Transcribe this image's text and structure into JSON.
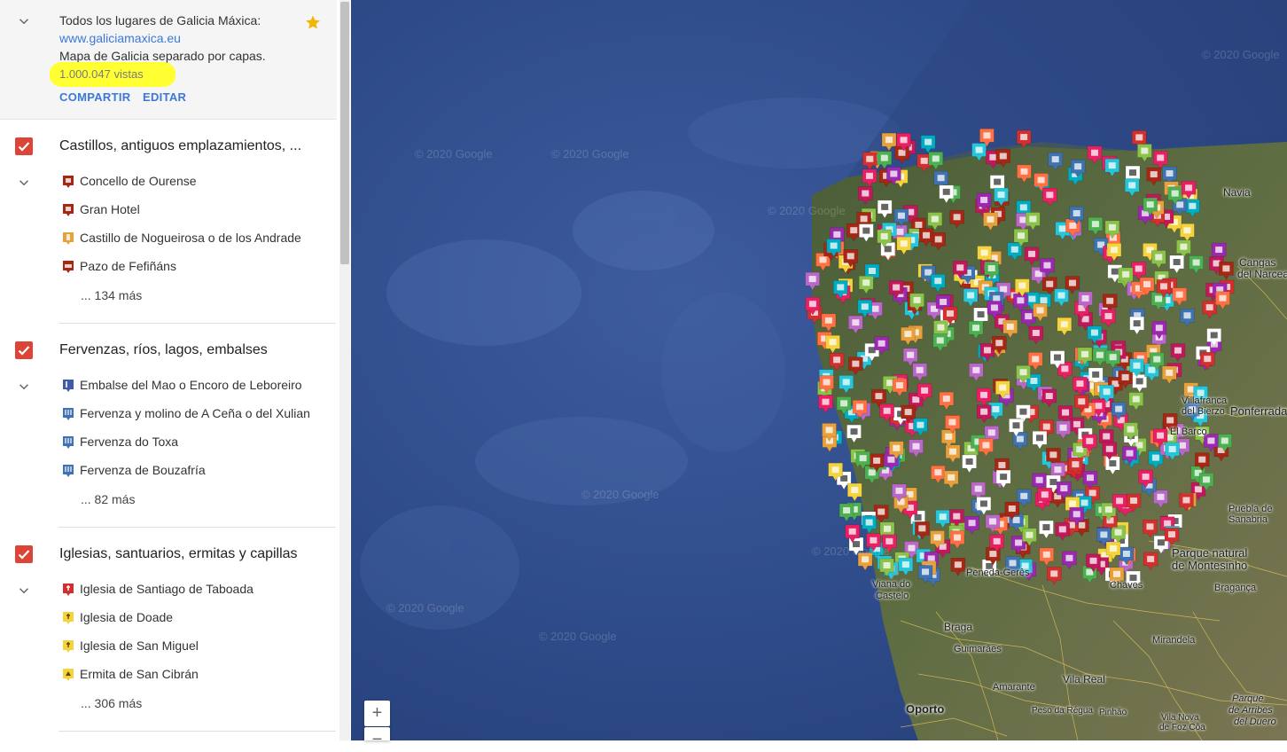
{
  "header": {
    "title": "Todos los lugares de Galicia Máxica:",
    "url": "www.galiciamaxica.eu",
    "description": "Mapa de Galicia separado por capas.",
    "views": "1.000.047 vistas",
    "share_label": "COMPARTIR",
    "edit_label": "EDITAR",
    "star_icon": "star-icon",
    "highlight_color": "#ffff33"
  },
  "layers": [
    {
      "title": "Castillos, antiguos emplazamientos, ...",
      "items": [
        {
          "label": "Concello de Ourense",
          "color": "#a52714"
        },
        {
          "label": "Gran Hotel",
          "color": "#a52714"
        },
        {
          "label": "Castillo de Nogueirosa o de los Andrade",
          "color": "#e8a03c"
        },
        {
          "label": "Pazo de Fefiñáns",
          "color": "#a52714"
        }
      ],
      "more": "... 134 más"
    },
    {
      "title": "Fervenzas, ríos, lagos, embalses",
      "items": [
        {
          "label": "Embalse del Mao o Encoro de Leboreiro",
          "color": "#3f5ba9"
        },
        {
          "label": "Fervenza y molino de A Ceña o del Xulian",
          "color": "#3f72b0"
        },
        {
          "label": "Fervenza do Toxa",
          "color": "#3f72b0"
        },
        {
          "label": "Fervenza de Bouzafría",
          "color": "#3f72b0"
        }
      ],
      "more": "... 82 más"
    },
    {
      "title": "Iglesias, santuarios, ermitas y capillas",
      "items": [
        {
          "label": "Iglesia de Santiago de Taboada",
          "color": "#d32f2f"
        },
        {
          "label": "Iglesia de Doade",
          "color": "#f5d33d"
        },
        {
          "label": "Iglesia de San Miguel",
          "color": "#f5d33d"
        },
        {
          "label": "Ermita de San Cibrán",
          "color": "#f5d33d"
        }
      ],
      "more": "... 306 más"
    }
  ],
  "map": {
    "zoom_in": "+",
    "zoom_out": "−",
    "watermark": "© 2020 Google",
    "labels": [
      {
        "text": "Navia"
      },
      {
        "text": "Cangas"
      },
      {
        "text": "del Narcea"
      },
      {
        "text": "Ponferrada"
      },
      {
        "text": "Villafranca"
      },
      {
        "text": "del Bierzo"
      },
      {
        "text": "El Barco"
      },
      {
        "text": "Puebla de"
      },
      {
        "text": "Sanabria"
      },
      {
        "text": "Parque natural"
      },
      {
        "text": "de Montesinho"
      },
      {
        "text": "Bragança"
      },
      {
        "text": "Chaves"
      },
      {
        "text": "Braga"
      },
      {
        "text": "Guimarães"
      },
      {
        "text": "Viana do"
      },
      {
        "text": "Castelo"
      },
      {
        "text": "Mirandela"
      },
      {
        "text": "Vila Real"
      },
      {
        "text": "Amarante"
      },
      {
        "text": "Oporto"
      },
      {
        "text": "Peso da Régua"
      },
      {
        "text": "Pinhão"
      },
      {
        "text": "Vila Nova"
      },
      {
        "text": "de Foz Côa"
      },
      {
        "text": "Parque"
      },
      {
        "text": "de Arribes"
      },
      {
        "text": "del Duero"
      },
      {
        "text": "Peneda-Gerês"
      }
    ]
  }
}
